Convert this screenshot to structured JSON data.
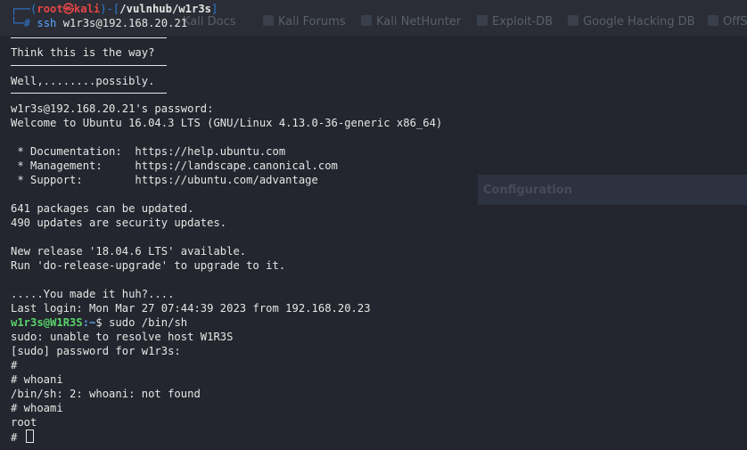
{
  "bookmarks": [
    {
      "label": "Kali Docs"
    },
    {
      "label": "Kali Forums"
    },
    {
      "label": "Kali NetHunter"
    },
    {
      "label": "Exploit-DB"
    },
    {
      "label": "Google Hacking DB"
    },
    {
      "label": "OffSec"
    }
  ],
  "background_panel": {
    "label": "Configuration"
  },
  "prompt": {
    "open": "┌──(",
    "user_host": "root㉿kali",
    "mid": ")-[",
    "path": "/vulnhub/w1r3s",
    "close": "]",
    "hash": "└─#",
    "command": "ssh",
    "args": " w1r3s@192.168.20.21"
  },
  "banner": {
    "line1": "Think this is the way?",
    "line2": "Well,........possibly."
  },
  "lines": [
    "w1r3s@192.168.20.21's password:",
    "Welcome to Ubuntu 16.04.3 LTS (GNU/Linux 4.13.0-36-generic x86_64)",
    "",
    " * Documentation:  https://help.ubuntu.com",
    " * Management:     https://landscape.canonical.com",
    " * Support:        https://ubuntu.com/advantage",
    "",
    "641 packages can be updated.",
    "490 updates are security updates.",
    "",
    "New release '18.04.6 LTS' available.",
    "Run 'do-release-upgrade' to upgrade to it.",
    "",
    ".....You made it huh?....",
    "Last login: Mon Mar 27 07:44:39 2023 from 192.168.20.23"
  ],
  "remote_prompt": {
    "user_host": "w1r3s@W1R3S",
    "path": ":~",
    "dollar": "$",
    "command": " sudo /bin/sh"
  },
  "tail_lines": [
    "sudo: unable to resolve host W1R3S",
    "[sudo] password for w1r3s:",
    "#",
    "# whoani",
    "/bin/sh: 2: whoani: not found",
    "# whoami",
    "root"
  ],
  "last_prompt": "# "
}
